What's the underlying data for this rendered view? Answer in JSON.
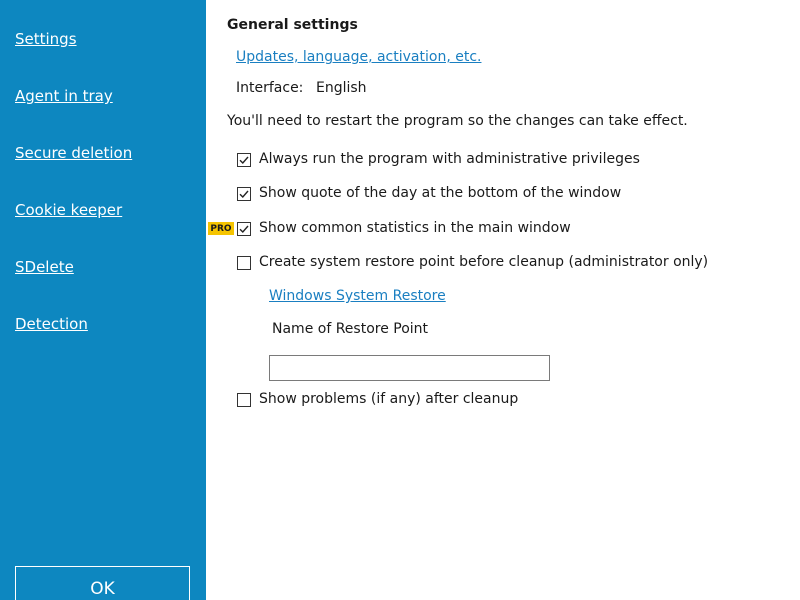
{
  "sidebar": {
    "items": [
      {
        "label": "Settings"
      },
      {
        "label": "Agent in tray"
      },
      {
        "label": "Secure deletion"
      },
      {
        "label": "Cookie keeper"
      },
      {
        "label": "SDelete"
      },
      {
        "label": "Detection"
      }
    ],
    "ok_label": "OK"
  },
  "general": {
    "title": "General settings",
    "link": "Updates, language, activation, etc.",
    "interface_label": "Interface:",
    "interface_value": "English",
    "restart_note": "You'll need to restart the program so the changes can take effect."
  },
  "options": [
    {
      "label": "Always run the program with administrative privileges",
      "checked": true
    },
    {
      "label": "Show quote of the day at the bottom of the window",
      "checked": true
    },
    {
      "label": "Show common statistics in the main window",
      "checked": true,
      "pro": true
    },
    {
      "label": "Create system restore point before cleanup (administrator only)",
      "checked": false
    },
    {
      "label": "Show problems (if any) after cleanup",
      "checked": false
    }
  ],
  "pro_badge": "PRO",
  "restore": {
    "link": "Windows System Restore",
    "name_label": "Name of Restore Point",
    "name_value": ""
  },
  "colors": {
    "sidebar": "#0d87c0",
    "link": "#1a7fc1",
    "pro_badge": "#f5c400"
  }
}
